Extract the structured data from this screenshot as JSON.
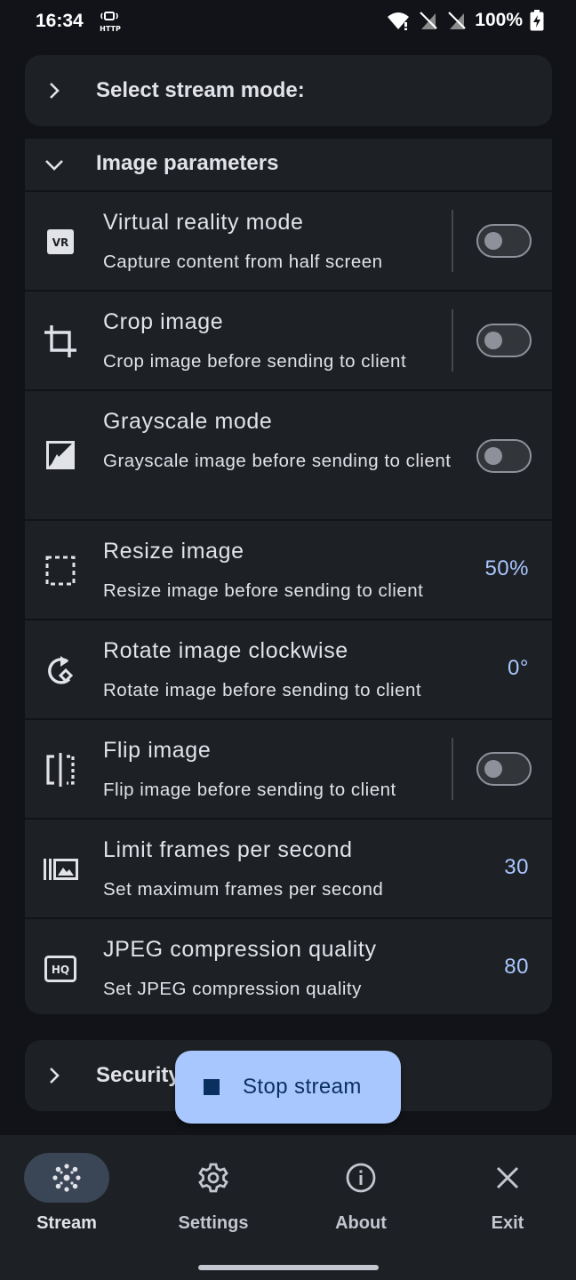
{
  "status_bar": {
    "time": "16:34",
    "http_label": "HTTP",
    "battery": "100%"
  },
  "stream_mode": {
    "title": "Select stream mode:"
  },
  "image_params": {
    "title": "Image parameters",
    "rows": [
      {
        "title": "Virtual reality mode",
        "subtitle": "Capture content from half screen",
        "icon": "vr-icon",
        "icon_text": "VR",
        "control": "toggle",
        "on": false
      },
      {
        "title": "Crop image",
        "subtitle": "Crop image before sending to client",
        "icon": "crop-icon",
        "control": "toggle",
        "on": false
      },
      {
        "title": "Grayscale mode",
        "subtitle": "Grayscale image before sending to client",
        "icon": "grayscale-icon",
        "control": "toggle",
        "on": false
      },
      {
        "title": "Resize image",
        "subtitle": "Resize image before sending to client",
        "icon": "resize-icon",
        "control": "value",
        "value": "50%"
      },
      {
        "title": "Rotate image clockwise",
        "subtitle": "Rotate image before sending to client",
        "icon": "rotate-icon",
        "control": "value",
        "value": "0°"
      },
      {
        "title": "Flip image",
        "subtitle": "Flip image before sending to client",
        "icon": "flip-icon",
        "control": "toggle",
        "on": false
      },
      {
        "title": "Limit frames per second",
        "subtitle": "Set maximum frames per second",
        "icon": "fps-icon",
        "control": "value",
        "value": "30"
      },
      {
        "title": "JPEG compression quality",
        "subtitle": "Set JPEG compression quality",
        "icon": "hq-icon",
        "icon_text": "HQ",
        "control": "value",
        "value": "80"
      }
    ]
  },
  "security": {
    "title": "Security"
  },
  "fab": {
    "label": "Stop stream",
    "icon": "stop-icon"
  },
  "nav": {
    "items": [
      {
        "label": "Stream",
        "icon": "stream-icon",
        "active": true
      },
      {
        "label": "Settings",
        "icon": "gear-icon",
        "active": false
      },
      {
        "label": "About",
        "icon": "info-icon",
        "active": false
      },
      {
        "label": "Exit",
        "icon": "close-icon",
        "active": false
      }
    ]
  },
  "colors": {
    "background": "#111318",
    "surface": "#1d2024",
    "accent": "#a9c7ff",
    "on_accent": "#0a305f",
    "nav_active": "#3a4556"
  }
}
